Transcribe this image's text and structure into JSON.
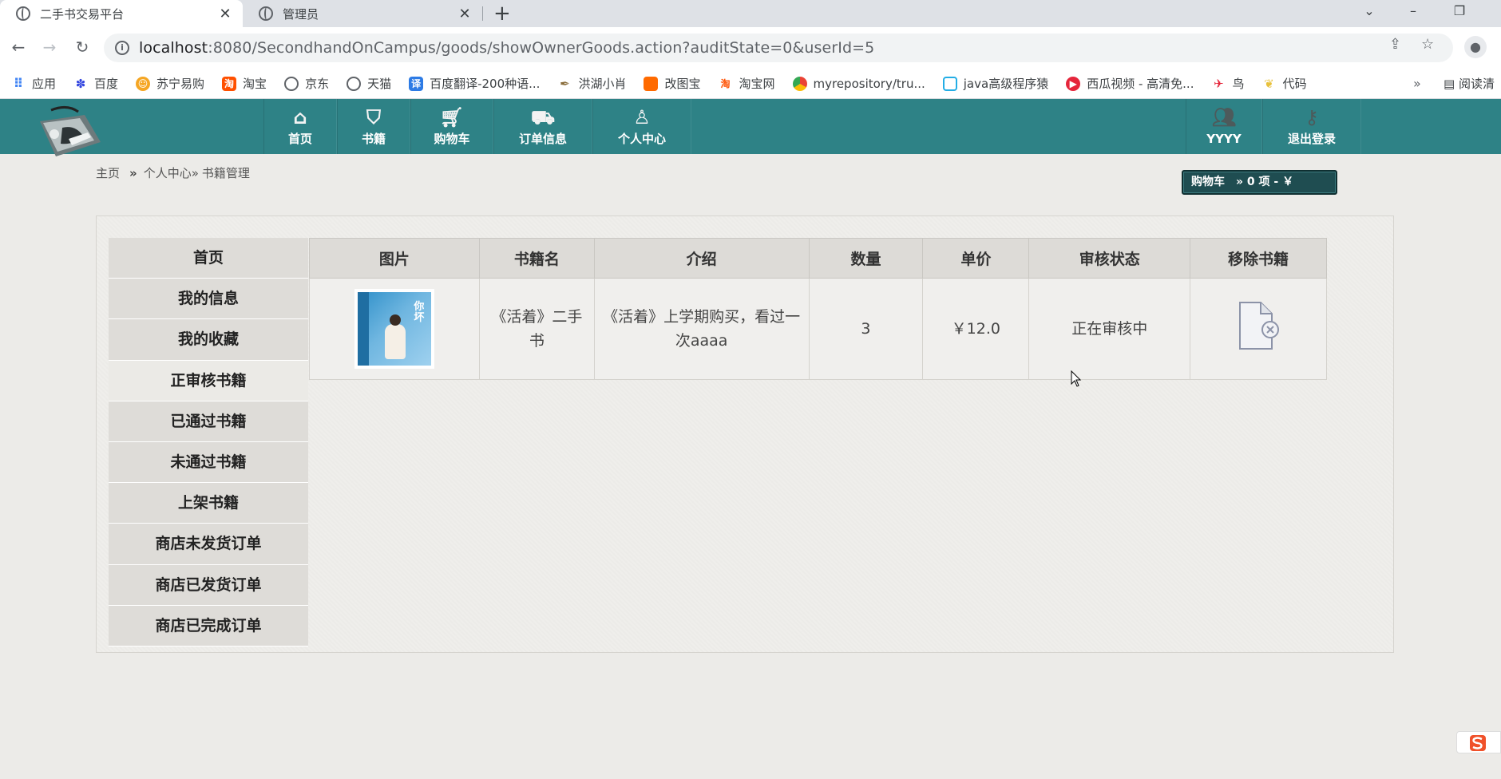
{
  "browser": {
    "tabs": [
      {
        "label": "二手书交易平台",
        "active": true
      },
      {
        "label": "管理员",
        "active": false
      }
    ],
    "url_host": "localhost",
    "url_path": ":8080/SecondhandOnCampus/goods/showOwnerGoods.action?auditState=0&userId=5",
    "bookmarks": [
      {
        "label": "应用",
        "icon": "apps-grid-icon",
        "color": "#4285f4"
      },
      {
        "label": "百度",
        "icon": "baidu-paw-icon",
        "color": "#3245df"
      },
      {
        "label": "苏宁易购",
        "icon": "suning-icon",
        "color": "#f5a623"
      },
      {
        "label": "淘宝",
        "icon": "taobao-icon",
        "color": "#ff5000"
      },
      {
        "label": "京东",
        "icon": "globe-icon",
        "color": "#5f6368"
      },
      {
        "label": "天猫",
        "icon": "globe-icon",
        "color": "#5f6368"
      },
      {
        "label": "百度翻译-200种语...",
        "icon": "translate-icon",
        "color": "#2d7be5"
      },
      {
        "label": "洪湖小肖",
        "icon": "feather-icon",
        "color": "#8a6d3b"
      },
      {
        "label": "改图宝",
        "icon": "gaitubao-icon",
        "color": "#ff6a00"
      },
      {
        "label": "淘宝网",
        "icon": "taobao-icon",
        "color": "#ff5000"
      },
      {
        "label": "myrepository/tru...",
        "icon": "chrome-icon",
        "color": "#34a853"
      },
      {
        "label": "java高级程序猿",
        "icon": "bilibili-icon",
        "color": "#23ade5"
      },
      {
        "label": "西瓜视频 - 高清免...",
        "icon": "xigua-icon",
        "color": "#e5263b"
      },
      {
        "label": "鸟",
        "icon": "bird-icon",
        "color": "#e5263b"
      },
      {
        "label": "代码",
        "icon": "leaf-icon",
        "color": "#e8c13b"
      }
    ],
    "bookmarks_more": "»",
    "reading_list": "阅读清"
  },
  "nav": {
    "items": [
      {
        "label": "首页",
        "icon": "home-icon"
      },
      {
        "label": "书籍",
        "icon": "basket-icon"
      },
      {
        "label": "购物车",
        "icon": "cart-icon"
      },
      {
        "label": "订单信息",
        "icon": "truck-icon"
      },
      {
        "label": "个人中心",
        "icon": "user-add-icon"
      }
    ],
    "user": {
      "label": "YYYY",
      "icon": "users-icon"
    },
    "logout": {
      "label": "退出登录",
      "icon": "key-icon"
    }
  },
  "breadcrumb": {
    "home": "主页",
    "sep": "»",
    "center": "个人中心»",
    "current": "书籍管理"
  },
  "cart_summary": "购物车　» 0 项 - ￥",
  "sidebar": {
    "items": [
      {
        "label": "首页"
      },
      {
        "label": "我的信息"
      },
      {
        "label": "我的收藏"
      },
      {
        "label": "正审核书籍",
        "current": true
      },
      {
        "label": "已通过书籍"
      },
      {
        "label": "未通过书籍"
      },
      {
        "label": "上架书籍"
      },
      {
        "label": "商店未发货订单"
      },
      {
        "label": "商店已发货订单"
      },
      {
        "label": "商店已完成订单"
      }
    ]
  },
  "table": {
    "headers": [
      "图片",
      "书籍名",
      "介绍",
      "数量",
      "单价",
      "审核状态",
      "移除书籍"
    ],
    "rows": [
      {
        "cover_title": "你坏",
        "name": "《活着》二手书",
        "intro": "《活着》上学期购买，看过一次aaaa",
        "quantity": "3",
        "price": "￥12.0",
        "status": "正在审核中"
      }
    ]
  },
  "colors": {
    "header_teal": "#2e8286",
    "cart_box": "#1f4d51",
    "page_bg": "#ecebe8"
  }
}
